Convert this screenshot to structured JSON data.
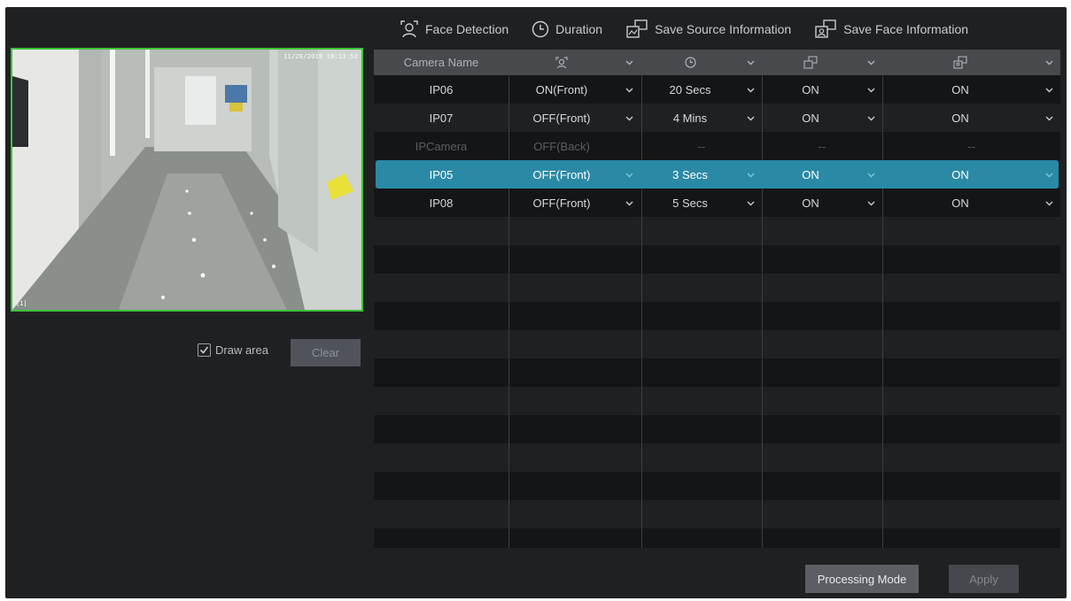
{
  "toolbar": {
    "face_detection": {
      "label": "Face Detection",
      "icon": "face-detection-icon"
    },
    "duration": {
      "label": "Duration",
      "icon": "clock-icon"
    },
    "save_source": {
      "label": "Save Source Information",
      "icon": "save-source-icon"
    },
    "save_face": {
      "label": "Save Face Information",
      "icon": "save-face-icon"
    }
  },
  "preview": {
    "timestamp": "11/26/2019 18:13:52",
    "channel": "[1]"
  },
  "draw_area": {
    "label": "Draw area",
    "checked": true
  },
  "clear_button": "Clear",
  "table": {
    "header": {
      "camera_name": "Camera Name",
      "face_detection_icon": "face-detection-icon",
      "duration_icon": "clock-icon",
      "save_source_icon": "save-source-icon",
      "save_face_icon": "save-face-icon"
    },
    "rows": [
      {
        "camera": "IP06",
        "detection": "ON(Front)",
        "duration": "20 Secs",
        "save_source": "ON",
        "save_face": "ON",
        "state": "normal"
      },
      {
        "camera": "IP07",
        "detection": "OFF(Front)",
        "duration": "4 Mins",
        "save_source": "ON",
        "save_face": "ON",
        "state": "normal"
      },
      {
        "camera": "IPCamera",
        "detection": "OFF(Back)",
        "duration": "--",
        "save_source": "--",
        "save_face": "--",
        "state": "disabled"
      },
      {
        "camera": "IP05",
        "detection": "OFF(Front)",
        "duration": "3 Secs",
        "save_source": "ON",
        "save_face": "ON",
        "state": "selected"
      },
      {
        "camera": "IP08",
        "detection": "OFF(Front)",
        "duration": "5 Secs",
        "save_source": "ON",
        "save_face": "ON",
        "state": "normal"
      }
    ]
  },
  "buttons": {
    "processing_mode": "Processing Mode",
    "apply": "Apply"
  },
  "colors": {
    "background": "#1f2022",
    "selection": "#2a8aa6",
    "preview_border": "#3bc43b"
  }
}
